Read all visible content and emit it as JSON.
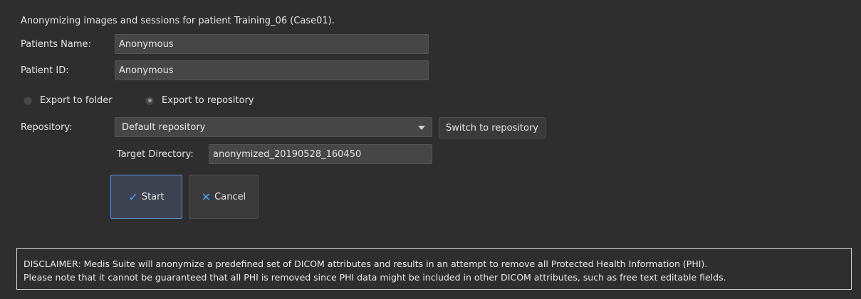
{
  "header": {
    "text": "Anonymizing images and sessions for patient Training_06 (Case01)."
  },
  "fields": {
    "patients_name": {
      "label": "Patients Name:",
      "value": "Anonymous"
    },
    "patient_id": {
      "label": "Patient ID:",
      "value": "Anonymous"
    }
  },
  "export": {
    "folder_label": "Export to folder",
    "repository_label": "Export to repository",
    "selected": "repository"
  },
  "repository": {
    "label": "Repository:",
    "selected": "Default repository",
    "switch_label": "Switch to repository"
  },
  "target_directory": {
    "label": "Target Directory:",
    "value": "anonymized_20190528_160450"
  },
  "actions": {
    "start_label": "Start",
    "cancel_label": "Cancel"
  },
  "disclaimer": {
    "line1": "DISCLAIMER: Medis Suite will anonymize a predefined set of DICOM attributes and results in an attempt to remove all Protected Health Information (PHI).",
    "line2": "Please note that it cannot be guaranteed that all PHI is removed since PHI data might be included in other DICOM attributes, such as free text editable fields."
  },
  "icons": {
    "start": "check-icon",
    "cancel": "x-icon",
    "dropdown": "chevron-down-icon"
  },
  "colors": {
    "background": "#2e2e2e",
    "input_background": "#464646",
    "accent": "#4aa3ff",
    "focus_border": "#5a8fd6"
  }
}
